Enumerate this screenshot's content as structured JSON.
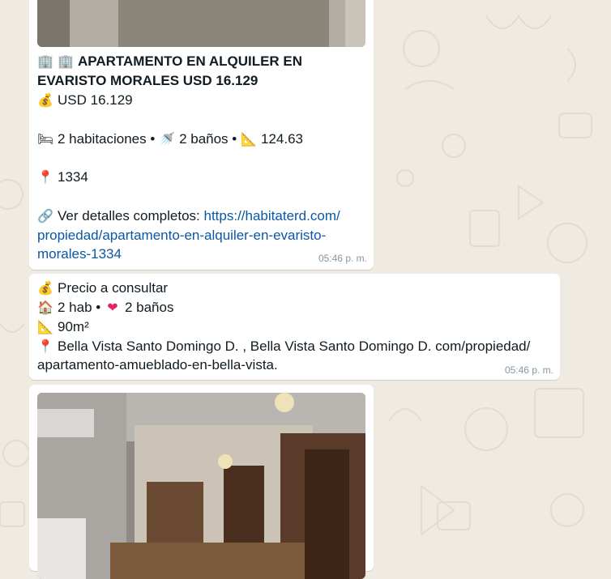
{
  "messages": [
    {
      "title_line1": "APARTAMENTO EN ALQUILER EN",
      "title_line2": "EVARISTO MORALES USD 16.129",
      "price": "USD 16.129",
      "rooms": "2 habitaciones",
      "sep1": "•",
      "baths": "2 baños",
      "sep2": "•",
      "area": "124.63",
      "location": "1334",
      "details_label": "Ver detalles completos:",
      "link_line1": "https://habitaterd.com/",
      "link_line2": "propiedad/apartamento-en-alquiler-en-evaristo-",
      "link_line3": "morales-1334",
      "time": "05:46 p. m.",
      "icons": [
        "building-icon",
        "building-icon",
        "money-bag-icon",
        "bed-icon",
        "shower-icon",
        "ruler-icon",
        "pin-icon",
        "link-icon"
      ]
    },
    {
      "price": "Precio a consultar",
      "rooms": "2 hab",
      "sep": "•",
      "baths": "2 baños",
      "area": "90m²",
      "location_line1": "Bella Vista Santo Domingo D. , Bella Vista Santo Domingo D. com/propiedad/",
      "location_line2": "apartamento-amueblado-en-bella-vista.",
      "time": "05:46 p. m.",
      "icons": [
        "money-bag-icon",
        "house-icon",
        "heart-icon",
        "ruler-icon",
        "pin-icon"
      ]
    }
  ],
  "colors": {
    "wallpaper": "#efeae2",
    "bubble": "#ffffff",
    "link": "#0b57a4",
    "timestamp": "#8696a0",
    "text": "#111b21"
  }
}
